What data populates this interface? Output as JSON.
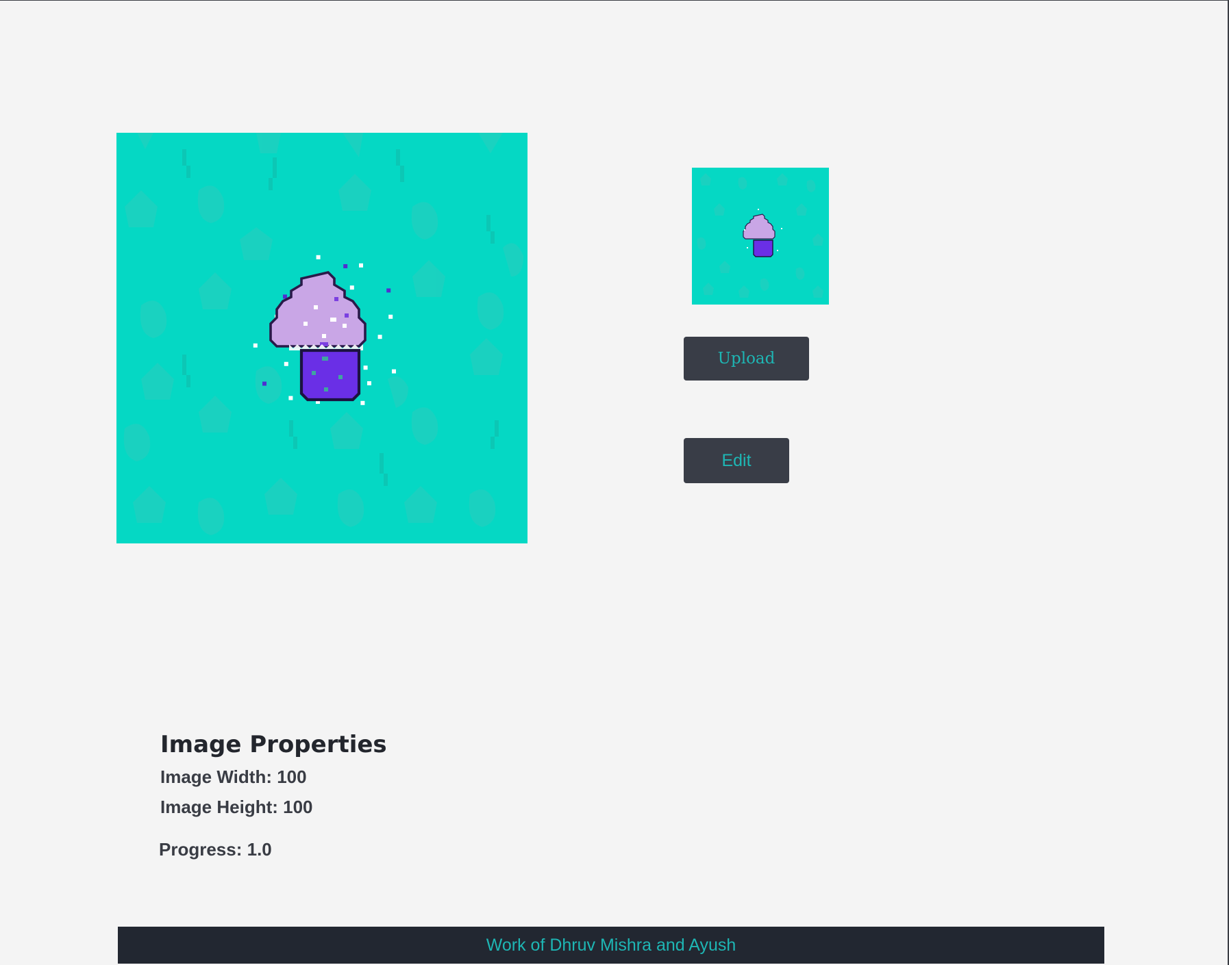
{
  "buttons": {
    "upload_label": "Upload",
    "edit_label": "Edit"
  },
  "properties": {
    "title": "Image Properties",
    "width_text": "Image Width: 100",
    "height_text": "Image Height: 100",
    "progress_text": "Progress: 1.0"
  },
  "footer": {
    "text": "Work of Dhruv Mishra and Ayush"
  },
  "colors": {
    "page_background": "#f4f4f4",
    "button_background": "#393d47",
    "accent": "#1eb6b4",
    "footer_background": "#222731",
    "image_background": "#05d8c4",
    "frosting": "#c9a6e6",
    "cup": "#6a2fe6"
  }
}
